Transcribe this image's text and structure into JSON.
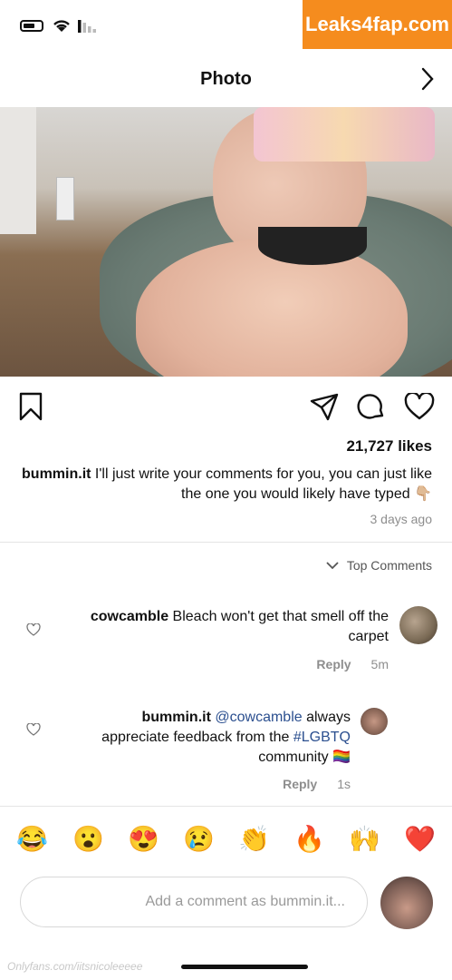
{
  "watermark": "Leaks4fap.com",
  "header": {
    "title": "Photo"
  },
  "post": {
    "likes": "21,727 likes",
    "caption_user": "bummin.it",
    "caption_text": " I'll just write your comments for you, you can just like the one you would likely have typed 👇🏼",
    "time_ago": "3 days ago"
  },
  "comments_section": {
    "sort_label": "Top Comments",
    "comments": [
      {
        "user": "cowcamble",
        "text": " Bleach won't get that smell off the carpet",
        "time": "5m",
        "reply": "Reply"
      },
      {
        "user": "bummin.it",
        "mention": " @cowcamble",
        "text": " always appreciate feedback from the ",
        "hashtag": "#LGBTQ",
        "text_end": " community 🏳️‍🌈",
        "time": "1s",
        "reply": "Reply"
      }
    ]
  },
  "emoji_bar": [
    "😂",
    "😮",
    "😍",
    "😢",
    "👏",
    "🔥",
    "🙌",
    "❤️"
  ],
  "composer": {
    "placeholder": "Add a comment as bummin.it..."
  },
  "footer": {
    "url": "Onlyfans.com/iitsnicoleeeee"
  }
}
